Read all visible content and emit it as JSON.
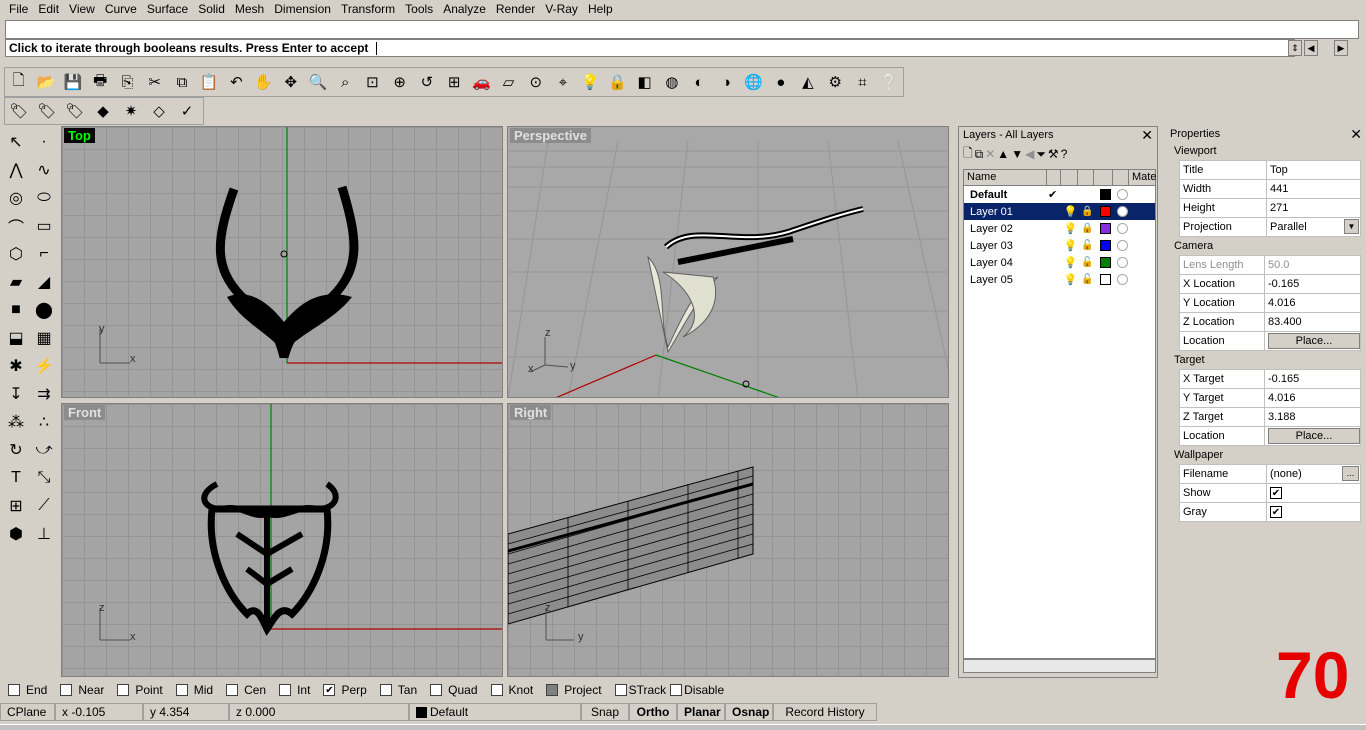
{
  "menu": [
    "File",
    "Edit",
    "View",
    "Curve",
    "Surface",
    "Solid",
    "Mesh",
    "Dimension",
    "Transform",
    "Tools",
    "Analyze",
    "Render",
    "V-Ray",
    "Help"
  ],
  "command": {
    "prompt": "Click to iterate through booleans results. Press Enter to accept"
  },
  "viewports": {
    "top": {
      "title": "Top",
      "axis1": "y",
      "axis2": "x"
    },
    "perspective": {
      "title": "Perspective",
      "axis1": "z",
      "axis2": "y",
      "axis3": "x"
    },
    "front": {
      "title": "Front",
      "axis1": "z",
      "axis2": "x"
    },
    "right": {
      "title": "Right",
      "axis1": "z",
      "axis2": "y"
    }
  },
  "layers": {
    "title": "Layers - All Layers",
    "columns": {
      "name": "Name",
      "material": "Mate"
    },
    "rows": [
      {
        "name": "Default",
        "check": "✔",
        "color": "#000000"
      },
      {
        "name": "Layer 01",
        "check": "",
        "color": "#ff0000"
      },
      {
        "name": "Layer 02",
        "check": "",
        "color": "#8a2be2"
      },
      {
        "name": "Layer 03",
        "check": "",
        "color": "#0000ff"
      },
      {
        "name": "Layer 04",
        "check": "",
        "color": "#008000"
      },
      {
        "name": "Layer 05",
        "check": "",
        "color": "#ffffff"
      }
    ]
  },
  "properties": {
    "title": "Properties",
    "viewport_section": "Viewport",
    "viewport": [
      {
        "k": "Title",
        "v": "Top"
      },
      {
        "k": "Width",
        "v": "441"
      },
      {
        "k": "Height",
        "v": "271"
      },
      {
        "k": "Projection",
        "v": "Parallel"
      }
    ],
    "camera_section": "Camera",
    "camera": [
      {
        "k": "Lens Length",
        "v": "50.0"
      },
      {
        "k": "X Location",
        "v": "-0.165"
      },
      {
        "k": "Y Location",
        "v": "4.016"
      },
      {
        "k": "Z Location",
        "v": "83.400"
      },
      {
        "k": "Location",
        "v": "Place..."
      }
    ],
    "target_section": "Target",
    "target": [
      {
        "k": "X Target",
        "v": "-0.165"
      },
      {
        "k": "Y Target",
        "v": "4.016"
      },
      {
        "k": "Z Target",
        "v": "3.188"
      },
      {
        "k": "Location",
        "v": "Place..."
      }
    ],
    "wallpaper_section": "Wallpaper",
    "wallpaper": [
      {
        "k": "Filename",
        "v": "(none)"
      },
      {
        "k": "Show",
        "v": "✔"
      },
      {
        "k": "Gray",
        "v": "✔"
      }
    ],
    "more_button": "..."
  },
  "osnaps": [
    {
      "label": "End",
      "checked": false
    },
    {
      "label": "Near",
      "checked": false
    },
    {
      "label": "Point",
      "checked": false
    },
    {
      "label": "Mid",
      "checked": false
    },
    {
      "label": "Cen",
      "checked": false
    },
    {
      "label": "Int",
      "checked": false
    },
    {
      "label": "Perp",
      "checked": true
    },
    {
      "label": "Tan",
      "checked": false
    },
    {
      "label": "Quad",
      "checked": false
    },
    {
      "label": "Knot",
      "checked": false
    },
    {
      "label": "Project",
      "checked": "filled"
    },
    {
      "label": "STrack",
      "checked": false
    },
    {
      "label": "Disable",
      "checked": false
    }
  ],
  "status": {
    "cplane": "CPlane",
    "x": "x -0.105",
    "y": "y 4.354",
    "z": "z 0.000",
    "layer": "Default",
    "snap": "Snap",
    "ortho": "Ortho",
    "planar": "Planar",
    "osnap": "Osnap",
    "record": "Record History"
  },
  "overlay_number": "70",
  "colors": {
    "accent": "#0a246a",
    "active_viewport_title": "#00ff00",
    "overlay": "#e60000"
  }
}
